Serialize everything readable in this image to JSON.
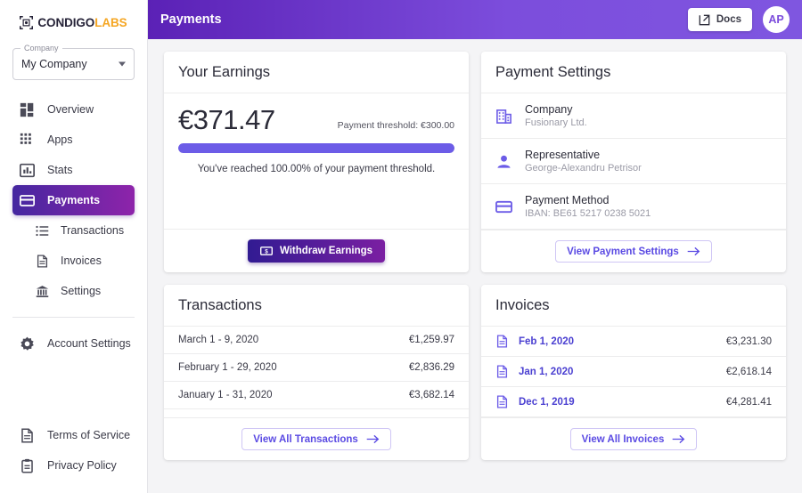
{
  "brand": {
    "name_dark": "CONDIGO",
    "name_accent": "LABS",
    "accent_color": "#f5a623"
  },
  "sidebar": {
    "company_selector": {
      "label": "Company",
      "value": "My Company"
    },
    "items": [
      {
        "label": "Overview",
        "icon": "dashboard-icon"
      },
      {
        "label": "Apps",
        "icon": "grid-icon"
      },
      {
        "label": "Stats",
        "icon": "bar-chart-icon"
      },
      {
        "label": "Payments",
        "icon": "credit-card-icon",
        "active": true
      }
    ],
    "sub_items": [
      {
        "label": "Transactions",
        "icon": "list-icon"
      },
      {
        "label": "Invoices",
        "icon": "document-icon"
      },
      {
        "label": "Settings",
        "icon": "bank-icon"
      }
    ],
    "account": {
      "label": "Account Settings",
      "icon": "gear-icon"
    },
    "footer_items": [
      {
        "label": "Terms of Service",
        "icon": "document-icon"
      },
      {
        "label": "Privacy Policy",
        "icon": "clipboard-icon"
      }
    ]
  },
  "topbar": {
    "title": "Payments",
    "docs_label": "Docs",
    "docs_icon": "external-link-icon",
    "avatar_initials": "AP",
    "gradient_from": "#5b21b6",
    "gradient_to": "#7f56e0"
  },
  "earnings": {
    "title": "Your Earnings",
    "amount": "€371.47",
    "threshold_text": "Payment threshold: €300.00",
    "progress_percent": 100,
    "note": "You've reached 100.00% of your payment threshold.",
    "withdraw_label": "Withdraw Earnings",
    "withdraw_icon": "money-icon",
    "progress_color": "#6c5ce7"
  },
  "payment_settings": {
    "title": "Payment Settings",
    "rows": [
      {
        "icon": "building-icon",
        "title": "Company",
        "value": "Fusionary Ltd."
      },
      {
        "icon": "person-icon",
        "title": "Representative",
        "value": "George-Alexandru Petrisor"
      },
      {
        "icon": "credit-card-icon",
        "title": "Payment Method",
        "value": "IBAN: BE61 5217 0238 5021"
      }
    ],
    "button_label": "View Payment Settings",
    "button_icon": "arrow-right-icon"
  },
  "transactions": {
    "title": "Transactions",
    "rows": [
      {
        "date": "March 1 - 9, 2020",
        "amount": "€1,259.97"
      },
      {
        "date": "February 1 - 29, 2020",
        "amount": "€2,836.29"
      },
      {
        "date": "January 1 - 31, 2020",
        "amount": "€3,682.14"
      }
    ],
    "button_label": "View All Transactions",
    "button_icon": "arrow-right-icon"
  },
  "invoices": {
    "title": "Invoices",
    "rows": [
      {
        "icon": "document-icon",
        "date": "Feb 1, 2020",
        "amount": "€3,231.30"
      },
      {
        "icon": "document-icon",
        "date": "Jan 1, 2020",
        "amount": "€2,618.14"
      },
      {
        "icon": "document-icon",
        "date": "Dec 1, 2019",
        "amount": "€4,281.41"
      }
    ],
    "button_label": "View All Invoices",
    "button_icon": "arrow-right-icon"
  }
}
